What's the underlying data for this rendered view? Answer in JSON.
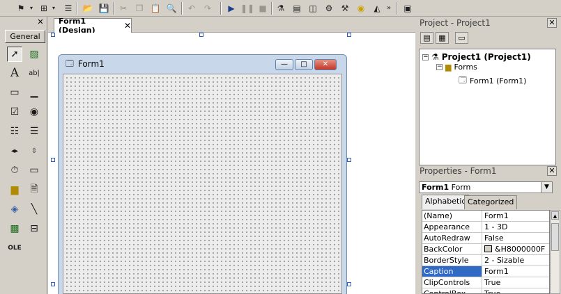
{
  "toolbar": {
    "overflow_glyph": "»"
  },
  "toolbox": {
    "tab_label": "General",
    "close_label": "✕"
  },
  "designer": {
    "tab_label": "Form1 (Design)",
    "tab_close": "✕",
    "form_title": "Form1",
    "min_glyph": "—",
    "max_glyph": "□",
    "close_glyph": "✕"
  },
  "project": {
    "title": "Project - Project1",
    "close_label": "✕",
    "tree": {
      "project": "Project1 (Project1)",
      "folder": "Forms",
      "form": "Form1 (Form1)"
    }
  },
  "properties": {
    "title": "Properties - Form1",
    "close_label": "✕",
    "object_name": "Form1",
    "object_type": "Form",
    "tabs": [
      "Alphabetic",
      "Categorized"
    ],
    "rows": [
      {
        "name": "(Name)",
        "value": "Form1"
      },
      {
        "name": "Appearance",
        "value": "1 - 3D"
      },
      {
        "name": "AutoRedraw",
        "value": "False"
      },
      {
        "name": "BackColor",
        "value": "&H8000000F"
      },
      {
        "name": "BorderStyle",
        "value": "2 - Sizable"
      },
      {
        "name": "Caption",
        "value": "Form1"
      },
      {
        "name": "ClipControls",
        "value": "True"
      },
      {
        "name": "ControlBox",
        "value": "True"
      }
    ]
  },
  "colors": {
    "selection": "#316ac5",
    "handle": "#2a5ec8"
  }
}
